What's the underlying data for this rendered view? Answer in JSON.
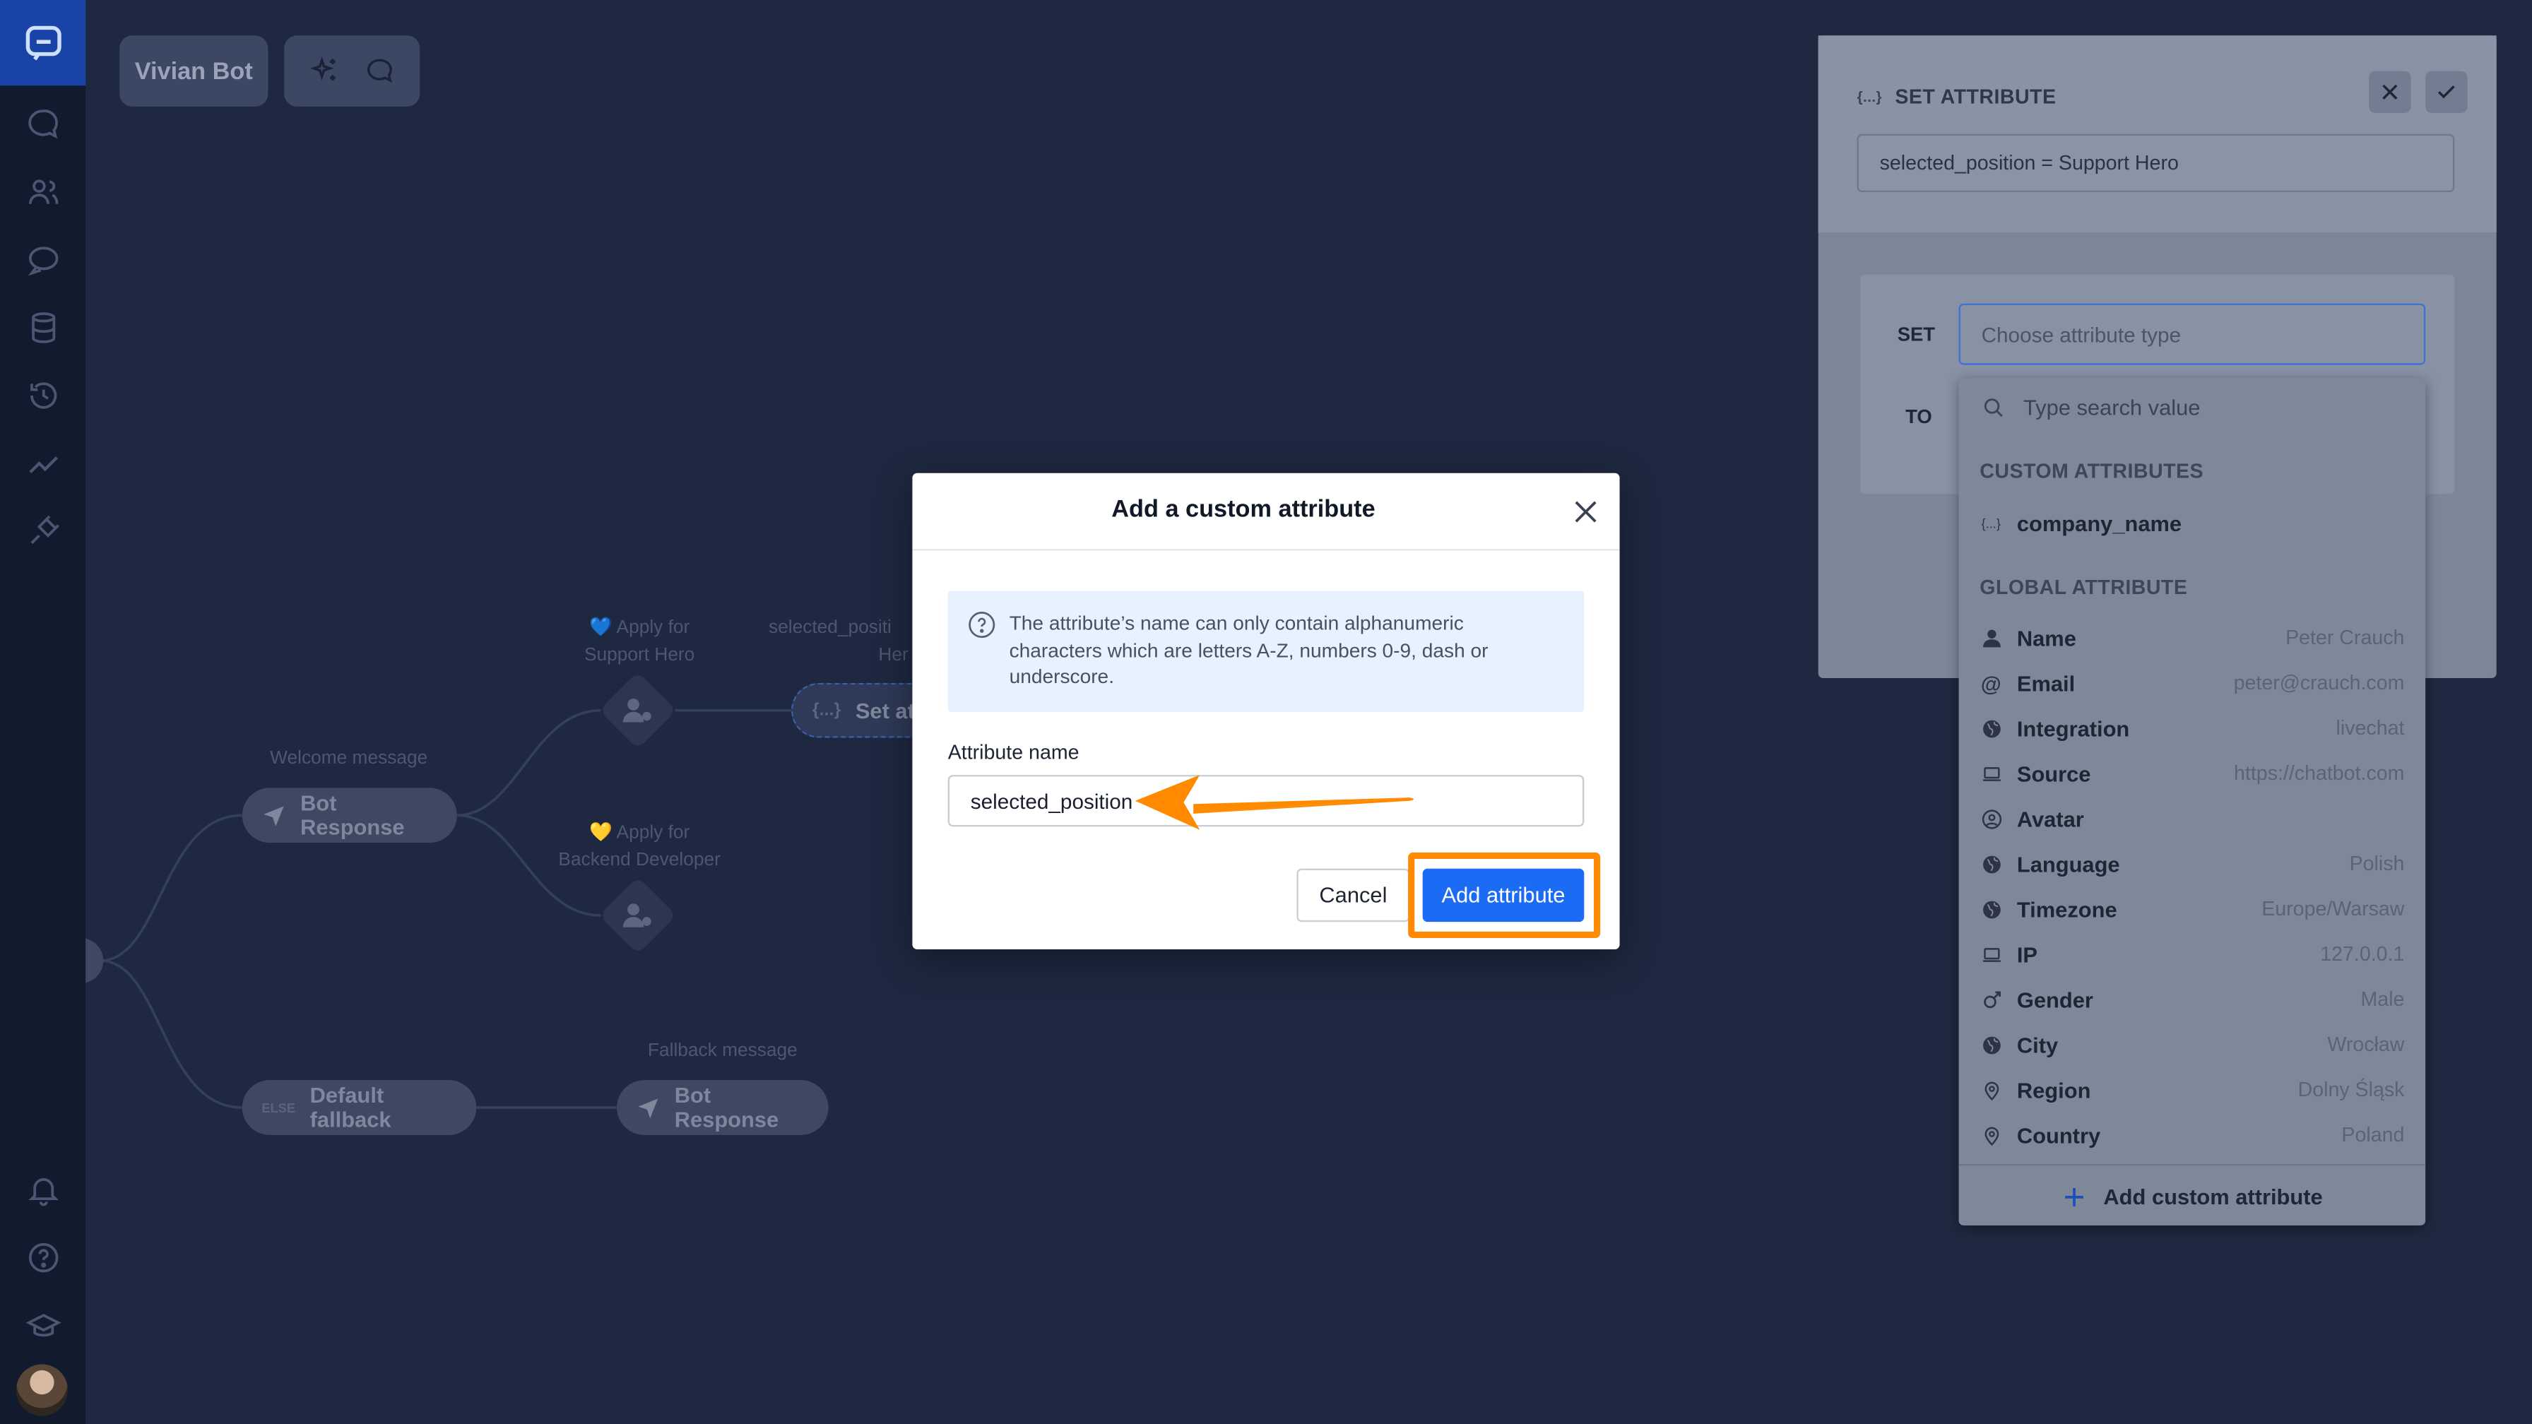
{
  "bot": {
    "name": "Vivian Bot"
  },
  "flow": {
    "welcome_label": "Welcome message",
    "bot_response_label": "Bot Response",
    "apply_support_label_line1": "💙 Apply for",
    "apply_support_label_line2": "Support Hero",
    "apply_backend_label_line1": "💛 Apply for",
    "apply_backend_label_line2": "Backend Developer",
    "set_attr_label_line1": "selected_positi",
    "set_attr_label_line2": "Her",
    "set_attr_node": "Set at",
    "else_badge": "ELSE",
    "default_fallback": "Default fallback",
    "fallback_label": "Fallback message",
    "fallback_response": "Bot Response"
  },
  "panel": {
    "title": "SET ATTRIBUTE",
    "summary": "selected_position = Support Hero",
    "set_label": "SET",
    "to_label": "TO",
    "select_placeholder": "Choose attribute type"
  },
  "dropdown": {
    "search_placeholder": "Type search value",
    "custom_header": "CUSTOM ATTRIBUTES",
    "custom_items": [
      {
        "name": "company_name",
        "icon": "braces-icon"
      }
    ],
    "global_header": "GLOBAL ATTRIBUTE",
    "global_items": [
      {
        "name": "Name",
        "value": "Peter Crauch",
        "icon": "person-icon"
      },
      {
        "name": "Email",
        "value": "peter@crauch.com",
        "icon": "at-icon"
      },
      {
        "name": "Integration",
        "value": "livechat",
        "icon": "globe-icon"
      },
      {
        "name": "Source",
        "value": "https://chatbot.com",
        "icon": "laptop-icon"
      },
      {
        "name": "Avatar",
        "value": "",
        "icon": "avatar-icon"
      },
      {
        "name": "Language",
        "value": "Polish",
        "icon": "globe-icon"
      },
      {
        "name": "Timezone",
        "value": "Europe/Warsaw",
        "icon": "globe-icon"
      },
      {
        "name": "IP",
        "value": "127.0.0.1",
        "icon": "laptop-icon"
      },
      {
        "name": "Gender",
        "value": "Male",
        "icon": "gender-icon"
      },
      {
        "name": "City",
        "value": "Wrocław",
        "icon": "globe-icon"
      },
      {
        "name": "Region",
        "value": "Dolny Śląsk",
        "icon": "pin-icon"
      },
      {
        "name": "Country",
        "value": "Poland",
        "icon": "pin-icon"
      }
    ],
    "add_label": "Add custom attribute"
  },
  "modal": {
    "title": "Add a custom attribute",
    "info": "The attribute’s name can only contain alphanumeric characters which are letters A-Z, numbers 0-9, dash or underscore.",
    "field_label": "Attribute name",
    "field_value": "selected_position",
    "cancel_label": "Cancel",
    "add_label": "Add attribute"
  },
  "colors": {
    "primary": "#1b6bf5",
    "highlight": "#ff8a00",
    "sidebar": "#121a2e",
    "canvas": "#1e2840"
  }
}
